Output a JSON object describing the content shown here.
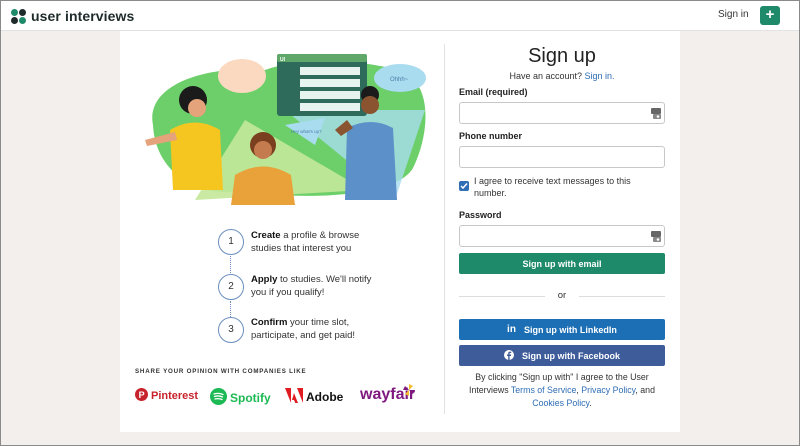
{
  "header": {
    "logo_text": "user interviews",
    "signin_label": "Sign in",
    "plus_label": "+"
  },
  "steps": [
    {
      "number": "1",
      "bold": "Create",
      "text": " a profile & browse studies that interest you"
    },
    {
      "number": "2",
      "bold": "Apply",
      "text": " to studies. We'll notify you if you qualify!"
    },
    {
      "number": "3",
      "bold": "Confirm",
      "text": " your time slot, participate, and get paid!"
    }
  ],
  "share": {
    "title": "SHARE YOUR OPINION WITH COMPANIES LIKE",
    "brands": [
      "Pinterest",
      "Spotify",
      "Adobe",
      "wayfair"
    ]
  },
  "illustration": {
    "window_label": "UI",
    "bubble_text": "Hey what's up?",
    "bubble_hi": "Ohhh~"
  },
  "form": {
    "title": "Sign up",
    "have_account": "Have an account? ",
    "signin_link": "Sign in.",
    "email_label": "Email (required)",
    "email_value": "",
    "phone_label": "Phone number",
    "phone_value": "",
    "checkbox_checked": true,
    "checkbox_label": "I agree to receive text messages to this number.",
    "password_label": "Password",
    "password_value": "",
    "email_button": "Sign up with email",
    "or_text": "or",
    "linkedin_button": "Sign up with LinkedIn",
    "facebook_button": "Sign up with Facebook",
    "legal_prefix": "By clicking \"Sign up with\" I agree to the User Interviews ",
    "terms_link": "Terms of Service",
    "legal_mid": ", ",
    "privacy_link": "Privacy Policy",
    "legal_and": ", and ",
    "cookies_link": "Cookies Policy",
    "legal_end": "."
  },
  "colors": {
    "accent_green": "#1e8a6a",
    "link_blue": "#2f6db5",
    "linkedin": "#1d6fb5",
    "facebook": "#3f5c9a"
  }
}
